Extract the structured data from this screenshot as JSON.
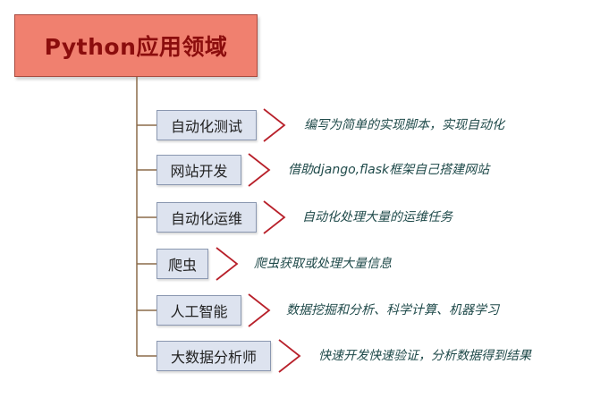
{
  "root": {
    "title": "Python应用领域"
  },
  "branches": [
    {
      "label": "自动化测试",
      "description": "编写为简单的实现脚本，实现自动化"
    },
    {
      "label": "网站开发",
      "description": "借助django,flask框架自己搭建网站"
    },
    {
      "label": "自动化运维",
      "description": "自动化处理大量的运维任务"
    },
    {
      "label": "爬虫",
      "description": "爬虫获取或处理大量信息"
    },
    {
      "label": "人工智能",
      "description": "数据挖掘和分析、科学计算、机器学习"
    },
    {
      "label": "大数据分析师",
      "description": "快速开发快速验证，分析数据得到结果"
    }
  ],
  "colors": {
    "root_fill": "#f0806f",
    "root_text": "#8b0d0d",
    "branch_fill": "#dde3ef",
    "branch_border": "#8a97b0",
    "connector": "#8b6b4a",
    "chevron": "#b8202a",
    "description_text": "#1f4a4a"
  }
}
